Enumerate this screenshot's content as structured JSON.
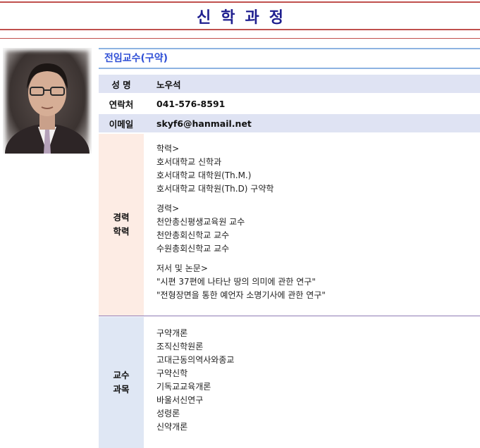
{
  "header": {
    "title": "신학과정"
  },
  "profile": {
    "section_title": "전임교수(구약)",
    "name_label": "성 명",
    "name": "노우석",
    "phone_label": "연락처",
    "phone": "041-576-8591",
    "email_label": "이메일",
    "email": "skyf6@hanmail.net"
  },
  "career": {
    "label_line1": "경력",
    "label_line2": "학력",
    "groups": [
      {
        "heading": "학력>",
        "items": [
          "호서대학교 신학과",
          "호서대학교 대학원(Th.M.)",
          "호서대학교 대학원(Th.D) 구약학"
        ]
      },
      {
        "heading": "경력>",
        "items": [
          "천안총신평생교육원 교수",
          "천안총회신학교 교수",
          "수원총회신학교 교수"
        ]
      },
      {
        "heading": "저서 및 논문>",
        "items": [
          "\"시편 37편에 나타난 땅의 의미에 관한 연구\"",
          "\"전형장면을 통한 예언자 소명기사에 관한 연구\""
        ]
      }
    ]
  },
  "courses": {
    "label_line1": "교수",
    "label_line2": "과목",
    "items": [
      "구약개론",
      "조직신학원론",
      "고대근동의역사와종교",
      "구약신학",
      "기독교교육개론",
      "바울서신연구",
      "성령론",
      "신약개론"
    ]
  }
}
